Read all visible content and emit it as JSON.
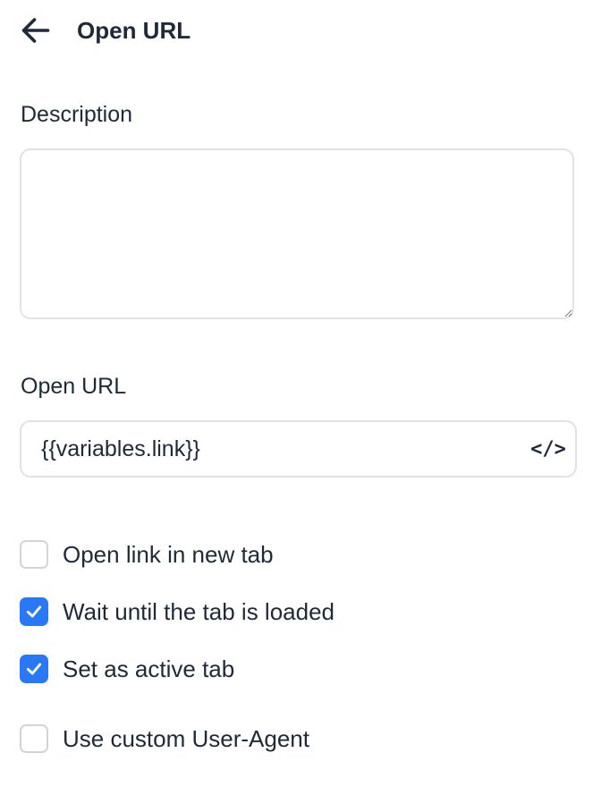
{
  "header": {
    "title": "Open URL",
    "back_icon": "arrow-left-icon"
  },
  "description": {
    "label": "Description",
    "value": ""
  },
  "url": {
    "label": "Open URL",
    "value": "{{variables.link}}",
    "code_icon": "code-icon"
  },
  "options": [
    {
      "label": "Open link in new tab",
      "checked": false
    },
    {
      "label": "Wait until the tab is loaded",
      "checked": true
    },
    {
      "label": "Set as active tab",
      "checked": true
    },
    {
      "label": "Use custom User-Agent",
      "checked": false
    }
  ],
  "colors": {
    "accent": "#2979f7",
    "border": "#e2e2e2",
    "text": "#1f2937"
  }
}
